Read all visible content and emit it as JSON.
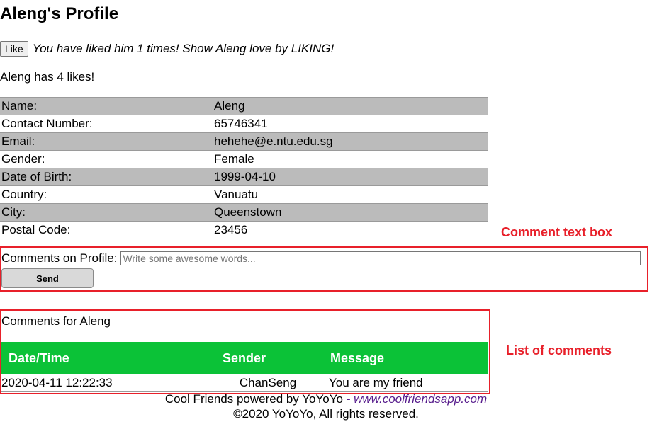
{
  "page": {
    "title": "Aleng's Profile"
  },
  "like": {
    "button_label": "Like",
    "message": "You have liked him 1 times! Show Aleng love by LIKING!",
    "count_text": "Aleng has 4 likes!"
  },
  "profile": {
    "rows": [
      {
        "label": "Name:",
        "value": "Aleng"
      },
      {
        "label": "Contact Number:",
        "value": "65746341"
      },
      {
        "label": "Email:",
        "value": "hehehe@e.ntu.edu.sg"
      },
      {
        "label": "Gender:",
        "value": "Female"
      },
      {
        "label": "Date of Birth:",
        "value": "1999-04-10"
      },
      {
        "label": "Country:",
        "value": "Vanuatu"
      },
      {
        "label": "City:",
        "value": "Queenstown"
      },
      {
        "label": "Postal Code:",
        "value": "23456"
      }
    ]
  },
  "comment_form": {
    "label": "Comments on Profile:",
    "placeholder": "Write some awesome words...",
    "value": "",
    "send_label": "Send"
  },
  "comments": {
    "title": "Comments for Aleng",
    "headers": [
      "Date/Time",
      "Sender",
      "Message"
    ],
    "rows": [
      {
        "datetime": "2020-04-11 12:22:33",
        "sender": "ChanSeng",
        "message": "You are my friend"
      }
    ]
  },
  "annotations": {
    "comment_box_label": "Comment text box",
    "comments_list_label": "List of comments",
    "color": "#e8202a"
  },
  "footer": {
    "powered_text": "Cool Friends powered by YoYoYo",
    "link_text": " - www.coolfriendsapp.com",
    "copyright": "©2020 YoYoYo, All rights reserved."
  },
  "colors": {
    "header_green": "#0bc237",
    "row_gray": "#bbbbbb"
  }
}
